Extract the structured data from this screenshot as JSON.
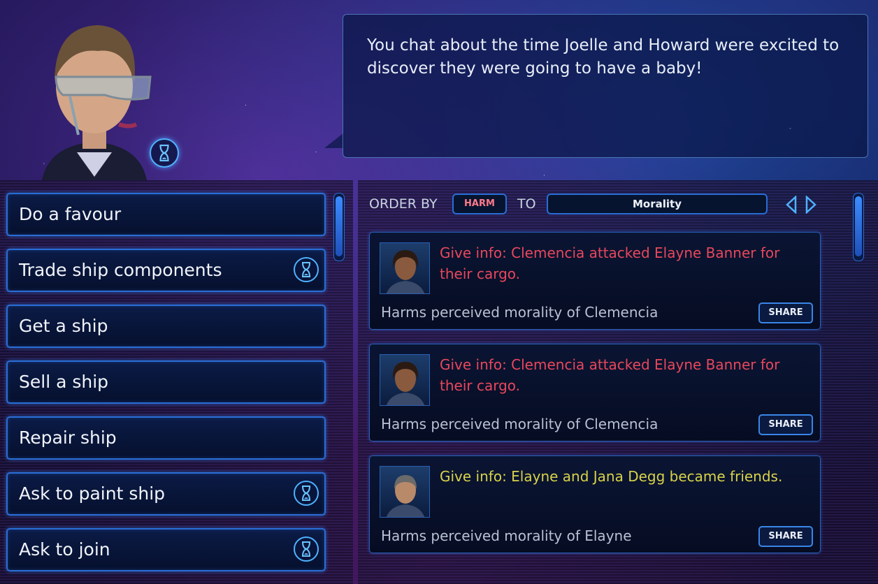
{
  "dialogue": {
    "text": "You chat about the time Joelle and Howard were excited to discover they were going to have a baby!"
  },
  "menu": {
    "items": [
      {
        "label": "Do a favour",
        "timed": false
      },
      {
        "label": "Trade ship components",
        "timed": true
      },
      {
        "label": "Get a ship",
        "timed": false
      },
      {
        "label": "Sell a ship",
        "timed": false
      },
      {
        "label": "Repair ship",
        "timed": false
      },
      {
        "label": "Ask to paint ship",
        "timed": true
      },
      {
        "label": "Ask to join",
        "timed": true
      }
    ]
  },
  "filter": {
    "order_by_label": "ORDER BY",
    "order_by_value": "HARM",
    "to_label": "TO",
    "to_value": "Morality"
  },
  "info_cards": [
    {
      "title": "Give info: Clemencia attacked Elayne Banner for their cargo.",
      "tone": "red",
      "effect": "Harms perceived morality of Clemencia",
      "share_label": "SHARE"
    },
    {
      "title": "Give info: Clemencia attacked Elayne Banner for their cargo.",
      "tone": "red",
      "effect": "Harms perceived morality of Clemencia",
      "share_label": "SHARE"
    },
    {
      "title": "Give info: Elayne and Jana Degg became friends.",
      "tone": "yellow",
      "effect": "Harms perceived morality of Elayne",
      "share_label": "SHARE"
    }
  ],
  "colors": {
    "accent": "#2a6dd6",
    "harm": "#e8475c",
    "positive": "#d8d24a"
  }
}
